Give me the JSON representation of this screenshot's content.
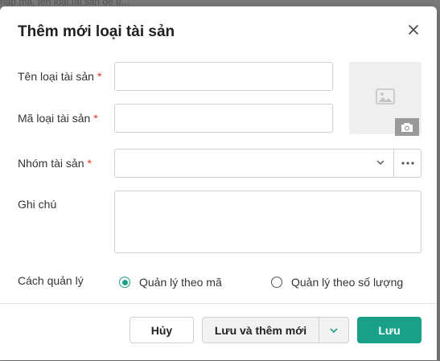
{
  "backdrop": {
    "text": "hập mã, tên loại tài sản để tì..."
  },
  "dialog": {
    "title": "Thêm mới loại tài sản",
    "fields": {
      "name": {
        "label": "Tên loại tài sản",
        "required_mark": "*",
        "value": ""
      },
      "code": {
        "label": "Mã loại tài sản",
        "required_mark": "*",
        "value": ""
      },
      "group": {
        "label": "Nhóm tài sản",
        "required_mark": "*",
        "value": ""
      },
      "note": {
        "label": "Ghi chú",
        "value": ""
      }
    },
    "management": {
      "label": "Cách quản lý",
      "options": [
        {
          "label": "Quản lý theo mã",
          "selected": true
        },
        {
          "label": "Quản lý theo số lượng",
          "selected": false
        }
      ]
    },
    "footer": {
      "cancel": "Hủy",
      "save_and_new": "Lưu và thêm mới",
      "save": "Lưu"
    }
  },
  "colors": {
    "primary": "#1aa088",
    "required": "#e5322d"
  },
  "icons": [
    "close-icon",
    "image-placeholder-icon",
    "camera-icon",
    "chevron-down-icon",
    "more-icon"
  ]
}
